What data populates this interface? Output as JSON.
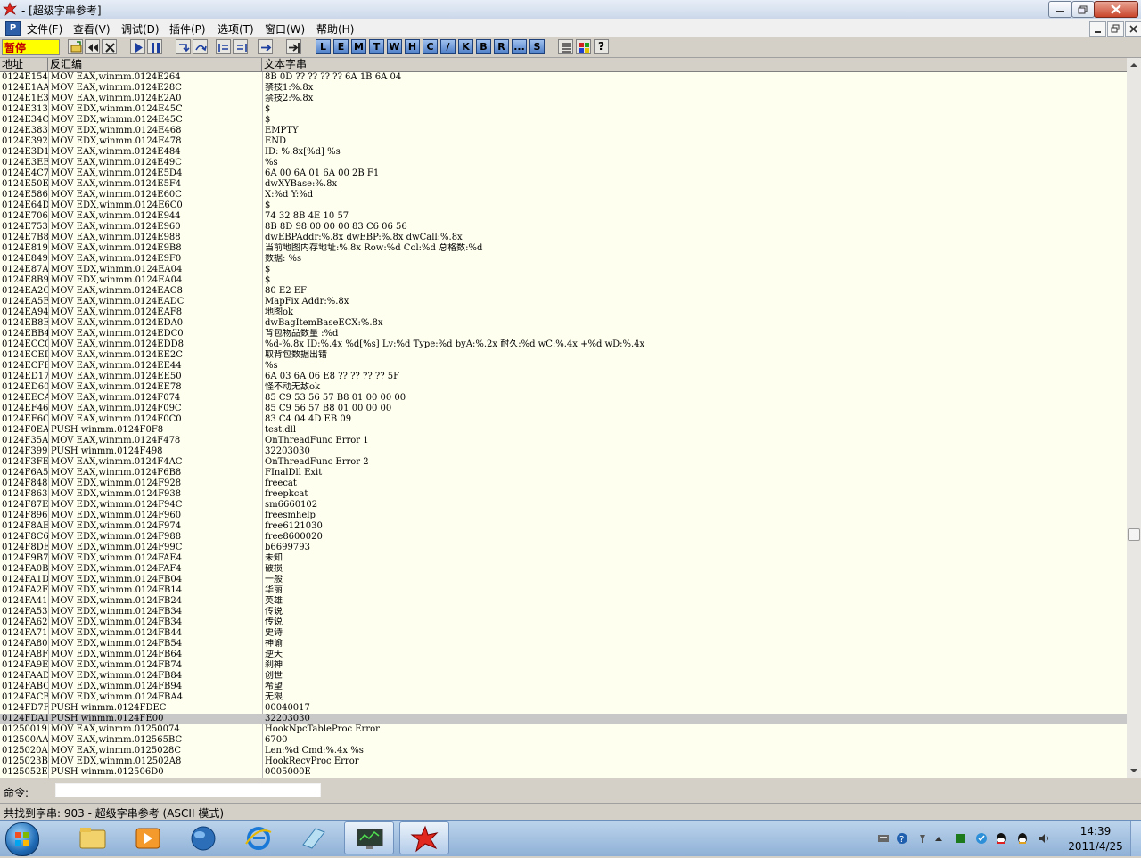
{
  "window": {
    "title": "- [超级字串参考]"
  },
  "menu": {
    "items": [
      "文件(F)",
      "查看(V)",
      "调试(D)",
      "插件(P)",
      "选项(T)",
      "窗口(W)",
      "帮助(H)"
    ],
    "logo": "P"
  },
  "toolbar": {
    "status": "暂停",
    "letters": [
      "L",
      "E",
      "M",
      "T",
      "W",
      "H",
      "C",
      "/",
      "K",
      "B",
      "R",
      "...",
      "S"
    ],
    "help": "?"
  },
  "columns": {
    "address": "地址",
    "disasm": "反汇编",
    "text": "文本字串"
  },
  "rows": [
    {
      "addr": "0124E154",
      "dis": "MOV EAX,winmm.0124E264",
      "text": "8B 0D ?? ?? ?? ?? 6A 1B 6A 04"
    },
    {
      "addr": "0124E1AA",
      "dis": "MOV EAX,winmm.0124E28C",
      "text": "禁技1:%.8x"
    },
    {
      "addr": "0124E1E3",
      "dis": "MOV EAX,winmm.0124E2A0",
      "text": "禁技2:%.8x"
    },
    {
      "addr": "0124E313",
      "dis": "MOV EDX,winmm.0124E45C",
      "text": "$"
    },
    {
      "addr": "0124E34C",
      "dis": "MOV EDX,winmm.0124E45C",
      "text": "$"
    },
    {
      "addr": "0124E383",
      "dis": "MOV EDX,winmm.0124E468",
      "text": "EMPTY"
    },
    {
      "addr": "0124E392",
      "dis": "MOV EDX,winmm.0124E478",
      "text": "END"
    },
    {
      "addr": "0124E3D1",
      "dis": "MOV EAX,winmm.0124E484",
      "text": "ID: %.8x[%d] %s"
    },
    {
      "addr": "0124E3EE",
      "dis": "MOV EAX,winmm.0124E49C",
      "text": "%s"
    },
    {
      "addr": "0124E4C7",
      "dis": "MOV EAX,winmm.0124E5D4",
      "text": "6A 00 6A 01 6A 00 2B F1"
    },
    {
      "addr": "0124E50E",
      "dis": "MOV EAX,winmm.0124E5F4",
      "text": "dwXYBase:%.8x"
    },
    {
      "addr": "0124E586",
      "dis": "MOV EAX,winmm.0124E60C",
      "text": "X:%d Y:%d"
    },
    {
      "addr": "0124E64D",
      "dis": "MOV EDX,winmm.0124E6C0",
      "text": "$"
    },
    {
      "addr": "0124E706",
      "dis": "MOV EAX,winmm.0124E944",
      "text": "74 32 8B 4E 10 57"
    },
    {
      "addr": "0124E753",
      "dis": "MOV EAX,winmm.0124E960",
      "text": "8B 8D 98 00 00 00 83 C6 06 56"
    },
    {
      "addr": "0124E7B8",
      "dis": "MOV EAX,winmm.0124E988",
      "text": "dwEBPAddr:%.8x dwEBP:%.8x dwCall:%.8x"
    },
    {
      "addr": "0124E819",
      "dis": "MOV EAX,winmm.0124E9B8",
      "text": "当前地图内存地址:%.8x Row:%d Col:%d 总格数:%d"
    },
    {
      "addr": "0124E849",
      "dis": "MOV EAX,winmm.0124E9F0",
      "text": "数据: %s"
    },
    {
      "addr": "0124E87A",
      "dis": "MOV EDX,winmm.0124EA04",
      "text": "$"
    },
    {
      "addr": "0124E8B9",
      "dis": "MOV EDX,winmm.0124EA04",
      "text": "$"
    },
    {
      "addr": "0124EA2C",
      "dis": "MOV EAX,winmm.0124EAC8",
      "text": "80 E2 EF"
    },
    {
      "addr": "0124EA5E",
      "dis": "MOV EAX,winmm.0124EADC",
      "text": "MapFix Addr:%.8x"
    },
    {
      "addr": "0124EA94",
      "dis": "MOV EAX,winmm.0124EAF8",
      "text": "地图ok"
    },
    {
      "addr": "0124EB8E",
      "dis": "MOV EAX,winmm.0124EDA0",
      "text": "dwBagItemBaseECX:%.8x"
    },
    {
      "addr": "0124EBB4",
      "dis": "MOV EAX,winmm.0124EDC0",
      "text": "背包物品数量 :%d"
    },
    {
      "addr": "0124ECC0",
      "dis": "MOV EAX,winmm.0124EDD8",
      "text": "%d-%.8x ID:%.4x %d[%s] Lv:%d Type:%d byA:%.2x 耐久:%d wC:%.4x +%d wD:%.4x"
    },
    {
      "addr": "0124ECED",
      "dis": "MOV EAX,winmm.0124EE2C",
      "text": "取背包数据出错"
    },
    {
      "addr": "0124ECFE",
      "dis": "MOV EAX,winmm.0124EE44",
      "text": "%s"
    },
    {
      "addr": "0124ED17",
      "dis": "MOV EAX,winmm.0124EE50",
      "text": "6A 03 6A 06 E8 ?? ?? ?? ?? 5F"
    },
    {
      "addr": "0124ED60",
      "dis": "MOV EAX,winmm.0124EE78",
      "text": "怪不动无敌ok"
    },
    {
      "addr": "0124EECA",
      "dis": "MOV EAX,winmm.0124F074",
      "text": "85 C9 53 56 57 B8 01 00 00 00"
    },
    {
      "addr": "0124EF46",
      "dis": "MOV EAX,winmm.0124F09C",
      "text": "85 C9 56 57 B8 01 00 00 00"
    },
    {
      "addr": "0124EF6C",
      "dis": "MOV EAX,winmm.0124F0C0",
      "text": "83 C4 04 4D EB 09"
    },
    {
      "addr": "0124F0EA",
      "dis": "PUSH winmm.0124F0F8",
      "text": "test.dll"
    },
    {
      "addr": "0124F35A",
      "dis": "MOV EAX,winmm.0124F478",
      "text": "OnThreadFunc Error 1"
    },
    {
      "addr": "0124F399",
      "dis": "PUSH winmm.0124F498",
      "text": "32203030"
    },
    {
      "addr": "0124F3FE",
      "dis": "MOV EAX,winmm.0124F4AC",
      "text": "OnThreadFunc Error 2"
    },
    {
      "addr": "0124F6A5",
      "dis": "MOV EAX,winmm.0124F6B8",
      "text": "FInalDll Exit"
    },
    {
      "addr": "0124F848",
      "dis": "MOV EDX,winmm.0124F928",
      "text": "freecat"
    },
    {
      "addr": "0124F863",
      "dis": "MOV EDX,winmm.0124F938",
      "text": "freepkcat"
    },
    {
      "addr": "0124F87E",
      "dis": "MOV EDX,winmm.0124F94C",
      "text": "sm6660102"
    },
    {
      "addr": "0124F896",
      "dis": "MOV EDX,winmm.0124F960",
      "text": "freesmhelp"
    },
    {
      "addr": "0124F8AE",
      "dis": "MOV EDX,winmm.0124F974",
      "text": "free6121030"
    },
    {
      "addr": "0124F8C6",
      "dis": "MOV EDX,winmm.0124F988",
      "text": "free8600020"
    },
    {
      "addr": "0124F8DE",
      "dis": "MOV EDX,winmm.0124F99C",
      "text": "b6699793"
    },
    {
      "addr": "0124F9B7",
      "dis": "MOV EDX,winmm.0124FAE4",
      "text": "未知"
    },
    {
      "addr": "0124FA0B",
      "dis": "MOV EDX,winmm.0124FAF4",
      "text": "破损"
    },
    {
      "addr": "0124FA1D",
      "dis": "MOV EDX,winmm.0124FB04",
      "text": "一般"
    },
    {
      "addr": "0124FA2F",
      "dis": "MOV EDX,winmm.0124FB14",
      "text": "华丽"
    },
    {
      "addr": "0124FA41",
      "dis": "MOV EDX,winmm.0124FB24",
      "text": "英雄"
    },
    {
      "addr": "0124FA53",
      "dis": "MOV EDX,winmm.0124FB34",
      "text": "传说"
    },
    {
      "addr": "0124FA62",
      "dis": "MOV EDX,winmm.0124FB34",
      "text": "传说"
    },
    {
      "addr": "0124FA71",
      "dis": "MOV EDX,winmm.0124FB44",
      "text": "史诗"
    },
    {
      "addr": "0124FA80",
      "dis": "MOV EDX,winmm.0124FB54",
      "text": "神谕"
    },
    {
      "addr": "0124FA8F",
      "dis": "MOV EDX,winmm.0124FB64",
      "text": "逆天"
    },
    {
      "addr": "0124FA9E",
      "dis": "MOV EDX,winmm.0124FB74",
      "text": "刹神"
    },
    {
      "addr": "0124FAAD",
      "dis": "MOV EDX,winmm.0124FB84",
      "text": "创世"
    },
    {
      "addr": "0124FABC",
      "dis": "MOV EDX,winmm.0124FB94",
      "text": "希望"
    },
    {
      "addr": "0124FACB",
      "dis": "MOV EDX,winmm.0124FBA4",
      "text": "无限"
    },
    {
      "addr": "0124FD7F",
      "dis": "PUSH winmm.0124FDEC",
      "text": "00040017"
    },
    {
      "addr": "0124FDA1",
      "dis": "PUSH winmm.0124FE00",
      "text": "32203030",
      "selected": true
    },
    {
      "addr": "01250019",
      "dis": "MOV EAX,winmm.01250074",
      "text": "HookNpcTableProc Error"
    },
    {
      "addr": "012500AA",
      "dis": "MOV EAX,winmm.012565BC",
      "text": "6700"
    },
    {
      "addr": "0125020A",
      "dis": "MOV EAX,winmm.0125028C",
      "text": "Len:%d Cmd:%.4x  %s"
    },
    {
      "addr": "0125023B",
      "dis": "MOV EDX,winmm.012502A8",
      "text": "HookRecvProc Error"
    },
    {
      "addr": "0125052E",
      "dis": "PUSH winmm.012506D0",
      "text": "0005000E"
    }
  ],
  "command": {
    "label": "命令:",
    "value": ""
  },
  "status": {
    "text": "共找到字串: 903 - 超级字串参考 (ASCII 模式)"
  },
  "taskbar": {
    "time": "14:39",
    "date": "2011/4/25"
  },
  "colors": {
    "selected_row": "#c8c8c8",
    "grid_bg": "#fffff0",
    "status_pill": "#ffff00"
  }
}
